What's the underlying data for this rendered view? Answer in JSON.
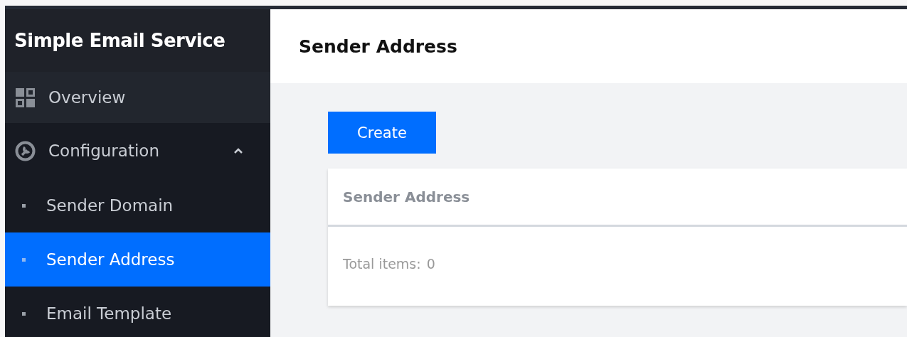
{
  "sidebar": {
    "title": "Simple Email Service",
    "items": [
      {
        "label": "Overview",
        "kind": "grid",
        "selected": false
      },
      {
        "label": "Configuration",
        "kind": "settings",
        "selected": false,
        "expanded": true,
        "children": [
          {
            "label": "Sender Domain",
            "selected": false
          },
          {
            "label": "Sender Address",
            "selected": true
          },
          {
            "label": "Email Template",
            "selected": false
          }
        ]
      }
    ]
  },
  "header": {
    "title": "Sender Address"
  },
  "toolbar": {
    "create_button": "Create"
  },
  "table": {
    "columns": [
      "Sender Address"
    ],
    "footer": {
      "label": "Total items:",
      "count": "0"
    }
  }
}
